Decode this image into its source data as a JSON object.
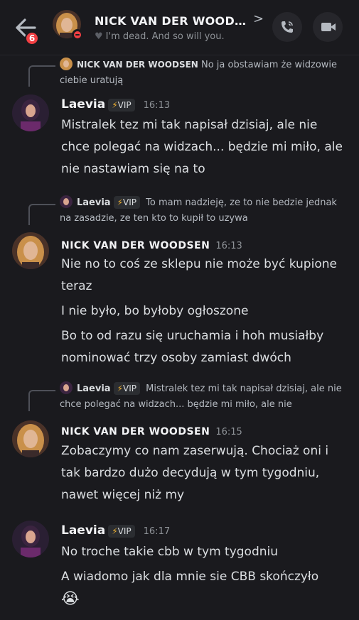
{
  "header": {
    "unread_badge": "6",
    "title": "NICK VAN DER WOOD…",
    "chevron": ">",
    "status_heart": "♥",
    "status_text": "I'm dead. And so will you."
  },
  "vip_badge": "VIP",
  "messages": [
    {
      "reply_author": "NICK VAN DER WOODSEN",
      "reply_text": "No ja obstawiam że widzowie ciebie uratują",
      "author": "Laevia",
      "time": "16:13",
      "lines": [
        "Mistralek tez mi tak napisał dzisiaj, ale nie chce polegać na widzach... będzie mi miło, ale nie nastawiam się na to"
      ]
    },
    {
      "reply_author": "Laevia",
      "reply_text": "To mam nadzieję, ze to nie bedzie jednak na zasadzie, ze ten kto to kupił to uzywa",
      "author": "NICK VAN DER WOODSEN",
      "time": "16:13",
      "lines": [
        "Nie no to coś ze sklepu nie może być kupione teraz",
        "I nie było, bo byłoby ogłoszone",
        "Bo to od razu się uruchamia i hoh musiałby nominować trzy osoby zamiast dwóch"
      ]
    },
    {
      "reply_author": "Laevia",
      "reply_text": "Mistralek tez mi tak napisał dzisiaj, ale nie chce polegać na widzach... będzie mi miło, ale nie",
      "author": "NICK VAN DER WOODSEN",
      "time": "16:15",
      "lines": [
        "Zobaczymy co nam zaserwują. Chociaż oni i tak bardzo dużo decydują w tym tygodniu, nawet więcej niż my"
      ]
    },
    {
      "author": "Laevia",
      "time": "16:17",
      "lines": [
        "No troche takie cbb w tym tygodniu",
        "A wiadomo jak dla mnie sie CBB skończyło"
      ],
      "emoji": "😭"
    }
  ],
  "colors": {
    "background": "#1a1a1e",
    "badge_red": "#f23f43",
    "vip_bolt": "#f0b232",
    "text": "#dbdee1"
  }
}
